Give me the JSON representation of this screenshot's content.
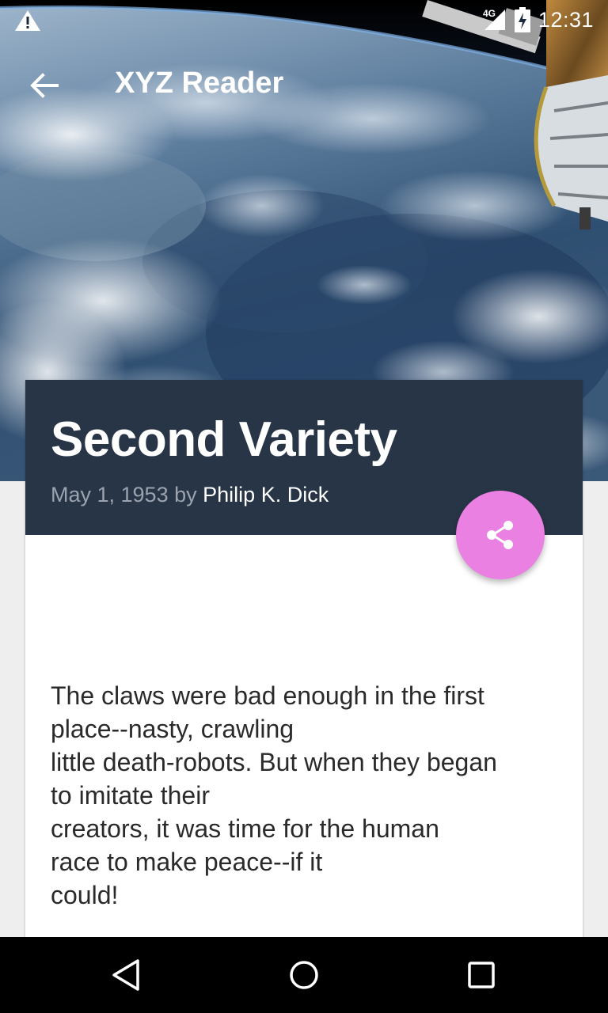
{
  "status_bar": {
    "time": "12:31",
    "network": "4G",
    "icons": [
      "warning-icon",
      "signal-icon",
      "battery-charging-icon"
    ]
  },
  "toolbar": {
    "title": "XYZ Reader",
    "back_icon": "arrow-back-icon"
  },
  "article": {
    "title": "Second Variety",
    "date": "May 1, 1953",
    "by": "by",
    "author": "Philip K. Dick",
    "body_lines": [
      "The claws were bad enough in the first",
      "place--nasty, crawling",
      "little death-robots. But when they began",
      "to imitate their",
      "creators, it was time for the human",
      "race to make peace--if it",
      "could!"
    ]
  },
  "share_fab": {
    "icon": "share-icon",
    "color": "#ea80e2"
  },
  "colors": {
    "header_bg": "#283547",
    "meta_text": "#9aa3ae",
    "body_text": "#2a2a2a",
    "page_bg": "#eeeeee"
  },
  "nav_bar": {
    "icons": [
      "nav-back-icon",
      "nav-home-icon",
      "nav-recents-icon"
    ]
  }
}
